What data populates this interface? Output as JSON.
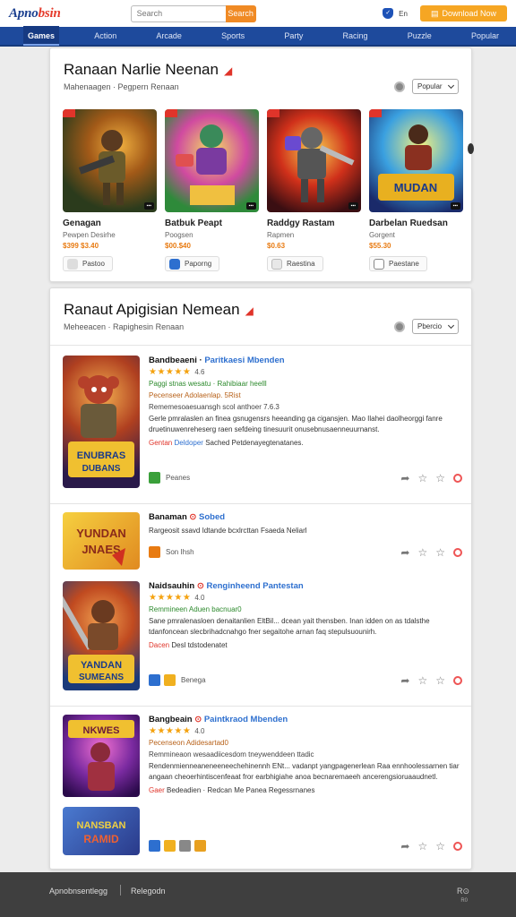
{
  "header": {
    "logo_main": "Apno",
    "logo_accent": "bsin",
    "search_placeholder": "Search",
    "search_button": "Search",
    "region_label": "En",
    "action_button": "Download Now"
  },
  "nav": [
    "Games",
    "Action",
    "Arcade",
    "Sports",
    "Party",
    "Racing",
    "Puzzle",
    "Popular"
  ],
  "section1": {
    "title": "Ranaan Narlie Neenan",
    "subtitle": "Mahenaagen · Pegpern Renaan",
    "sort_label": "Popular",
    "games": [
      {
        "name": "Genagan",
        "dev": "Pewpen Desirhe",
        "price": "$399 $3.40",
        "install": "Pastoo"
      },
      {
        "name": "Batbuk Peapt",
        "dev": "Poogsen",
        "price": "$00.$40",
        "install": "Paporng"
      },
      {
        "name": "Raddgy Rastam",
        "dev": "Rapmen",
        "price": "$0.63",
        "install": "Raestina"
      },
      {
        "name": "Darbelan Ruedsan",
        "dev": "Gorgent",
        "price": "$55.30",
        "install": "Paestane"
      }
    ]
  },
  "section2": {
    "title": "Ranaut Apigisian Nemean",
    "subtitle": "Meheeacen · Rapighesin Renaan",
    "sort_label": "Pbercio",
    "items": [
      {
        "title": "Bandbeaeni",
        "dev": "Paritkaesi Mbenden",
        "rating": "4.6",
        "line1": "Paggi stnas wesatu · Rahibiaar heelll",
        "line2": "Pecenseer Adolaenlap. 5Rist",
        "line3": "Rememesoaesuansgh scol anthoer 7.6.3",
        "desc": "Gerle pmralaslen an finea gsnugensrs heeanding ga cigansjen. Mao Ilahei daolheorggi fanre druetinuwenreheserg raen sefdeing tinesuurit onusebnusaenneuurnanst.",
        "meta_red": "Gentan",
        "meta_blue": "Deldoper",
        "meta_rest": "Sached Petdenayegtenatanes.",
        "foot_label": "Peanes"
      },
      {
        "title": "Banaman",
        "dev": "Sobed",
        "desc": "Rargeosit ssavd Idtande bcxlrcttan Fsaeda Neliarl",
        "foot_label": "Son Ihsh",
        "banner": "YUNDAN JNAES"
      },
      {
        "title": "Naidsauhin",
        "dev": "Renginheend Pantestan",
        "rating": "4.0",
        "line1": "Remmineen Aduen bacnuar0",
        "desc": "Sane pmralenasloen denaitanlien EltBil... dcean yait thensben. Inan idden on as tdalsthe tdanfoncean slecbrihadcnahgo fner segaitohe arnan faq stepulsuounirh.",
        "meta_red": "Dacen",
        "meta_rest": "Desl tdstodenatet",
        "foot_label": "Benega"
      },
      {
        "title": "Bangbeain",
        "dev": "Paintkraod Mbenden",
        "rating": "4.0",
        "line1": "Pecenseon Adidesartad0",
        "line2": "Remmineaon wesaadiicesdom tneywenddeen ttadic",
        "desc": "Rendenmienneaneneeneechehinennh ENt... vadanpt yangpagenerlean Raa ennhoolessarnen tiar angaan cheoerhintiscenfeaat fror earbhigiahe anoa becnaremaeeh ancerengsioruaaudnetl.",
        "meta_red": "Gaer",
        "meta_rest": "Bedeadien · Redcan Me Panea Regessrnanes",
        "foot_label": "",
        "banner": "NANSBAN RAMID"
      }
    ]
  },
  "footer": {
    "left": "Apnobnsentlegg",
    "link": "Relegodn",
    "right": "R⊙",
    "right_sub": "R0"
  },
  "colors": {
    "nav_bg": "#1e4a9c",
    "accent_orange": "#f08a24",
    "star": "#f4a20f",
    "link_blue": "#2d6fcf",
    "hot_red": "#e0342a"
  }
}
